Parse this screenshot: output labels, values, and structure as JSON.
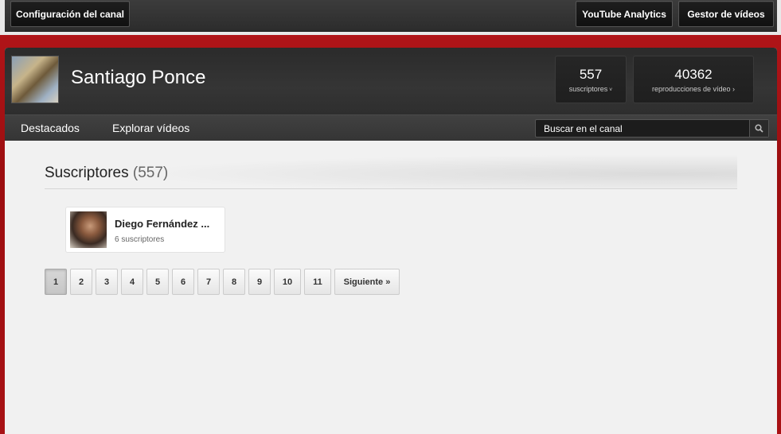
{
  "toolbar": {
    "config_label": "Configuración del canal",
    "analytics_label": "YouTube Analytics",
    "manager_label": "Gestor de vídeos"
  },
  "channel": {
    "name": "Santiago Ponce",
    "subscribers_count": "557",
    "subscribers_label": "suscriptores",
    "views_count": "40362",
    "views_label": "reproducciones de vídeo ›"
  },
  "nav": {
    "featured": "Destacados",
    "explore": "Explorar vídeos",
    "search_placeholder": "Buscar en el canal"
  },
  "section": {
    "title": "Suscriptores",
    "count": "(557)"
  },
  "subscriber": {
    "name": "Diego Fernández ...",
    "subs": "6 suscriptores"
  },
  "pagination": {
    "pages": [
      "1",
      "2",
      "3",
      "4",
      "5",
      "6",
      "7",
      "8",
      "9",
      "10",
      "11"
    ],
    "current": "1",
    "next": "Siguiente »"
  }
}
